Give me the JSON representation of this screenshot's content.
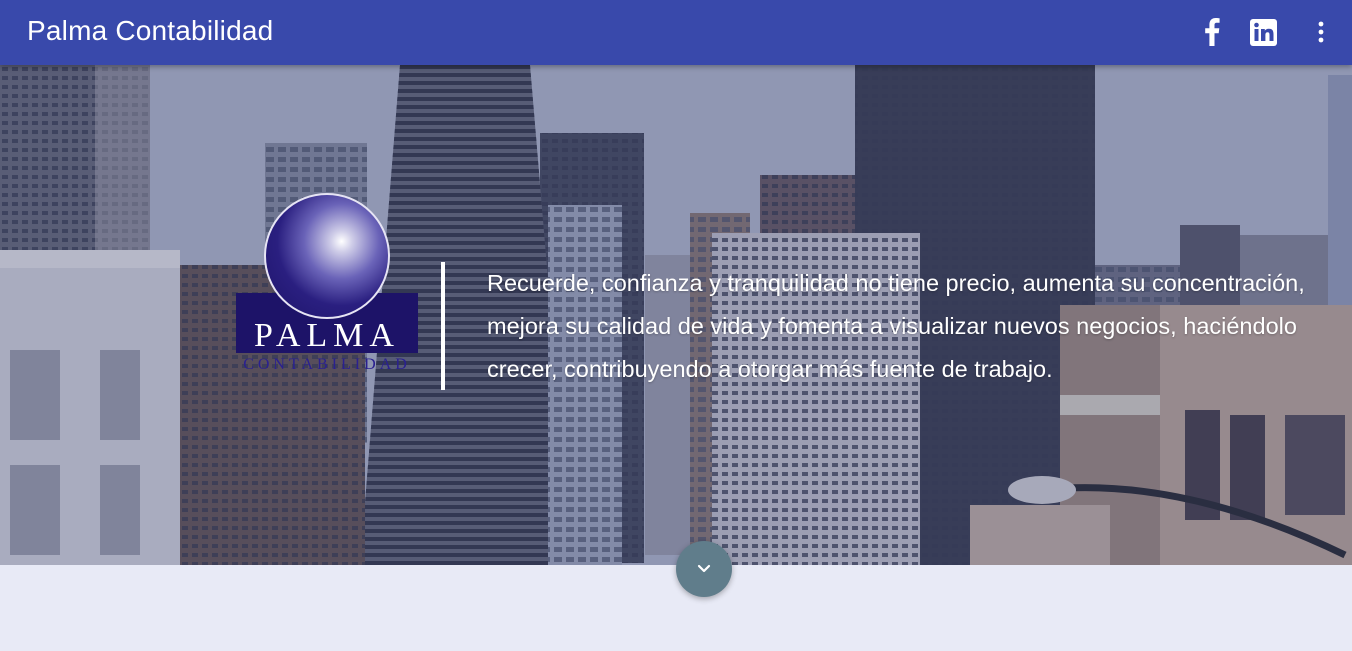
{
  "header": {
    "title": "Palma Contabilidad",
    "icons": [
      "facebook-icon",
      "linkedin-icon",
      "more-vert-icon"
    ]
  },
  "hero": {
    "logo": {
      "word": "PALMA",
      "sub": "CONTABILIDAD"
    },
    "tagline": "Recuerde, confianza y tranquilidad no tiene precio, aumenta su concentración, mejora su calidad de vida y fomenta a visualizar nuevos negocios, haciéndolo crecer, contribuyendo a otorgar más fuente de trabajo.",
    "scroll_icon": "chevron-down-icon"
  },
  "colors": {
    "toolbar": "#3949ab",
    "fab": "#607d8b",
    "page_background": "#e8eaf6",
    "logo_navy": "#1d1368"
  }
}
